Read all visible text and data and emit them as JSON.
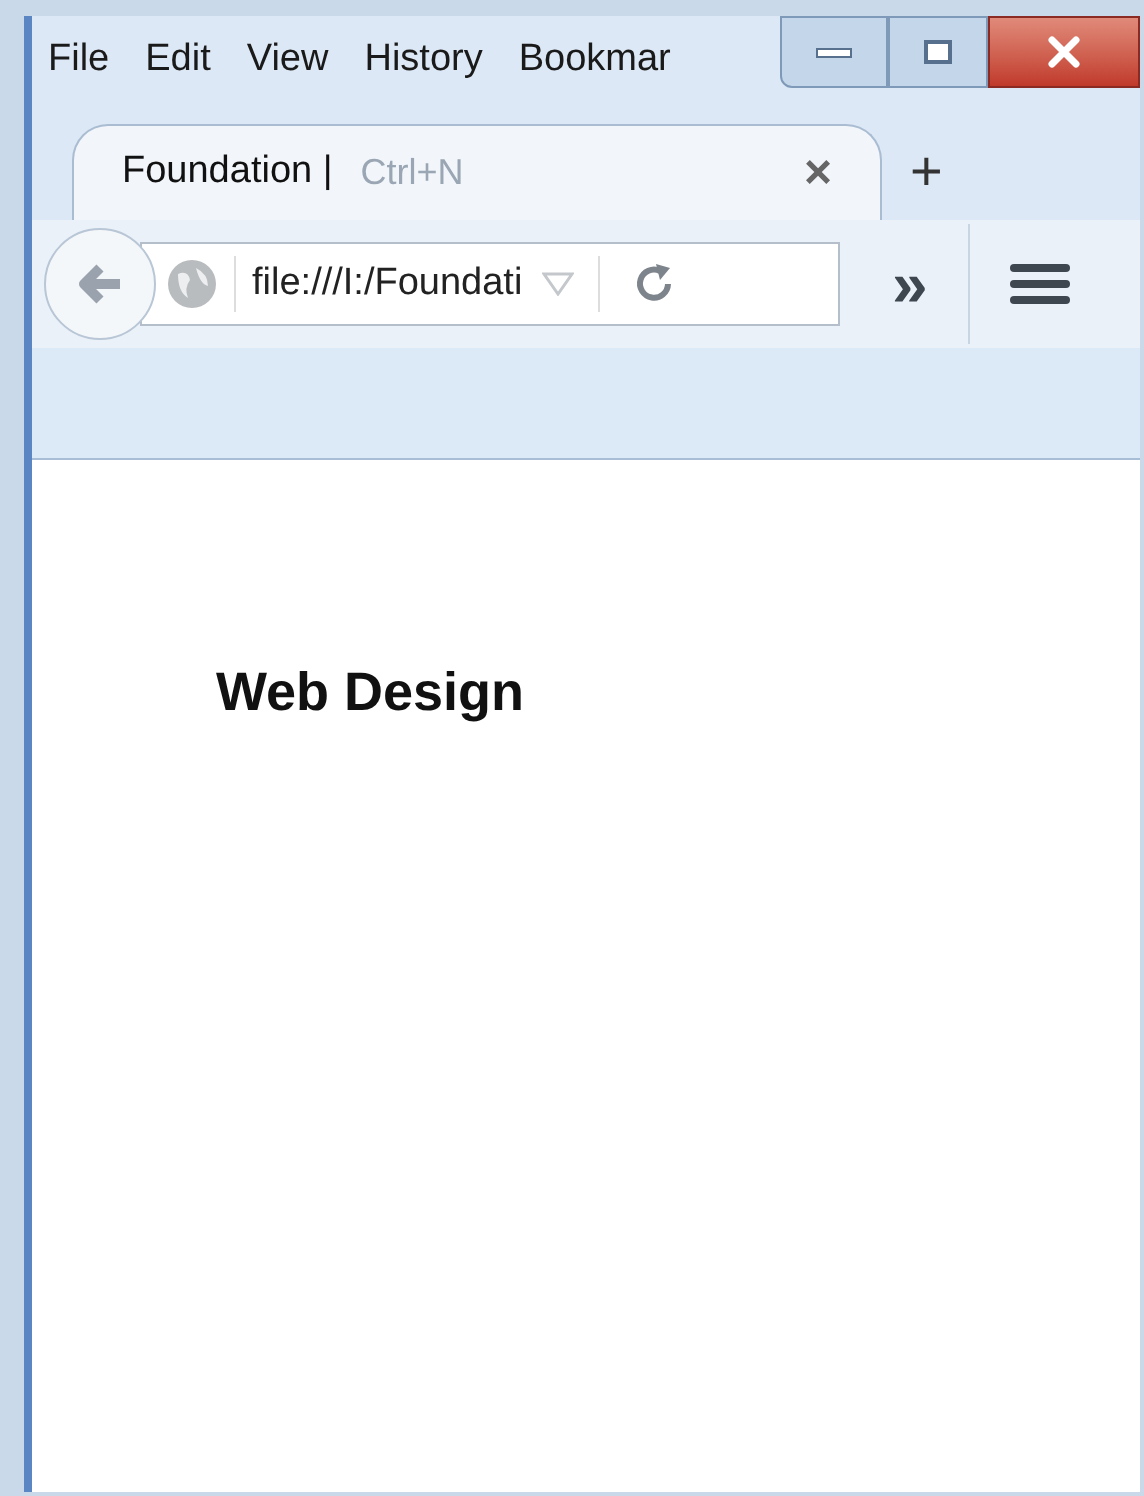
{
  "menu": [
    {
      "label": "File"
    },
    {
      "label": "Edit"
    },
    {
      "label": "View"
    },
    {
      "label": "History"
    },
    {
      "label": "Bookmar"
    }
  ],
  "tab": {
    "title": "Foundation |",
    "hint": "Ctrl+N",
    "close": "×",
    "new_tab": "+"
  },
  "address": {
    "value": "file:///I:/Foundati"
  },
  "overflow": "»",
  "page": {
    "heading": "Web Design"
  }
}
